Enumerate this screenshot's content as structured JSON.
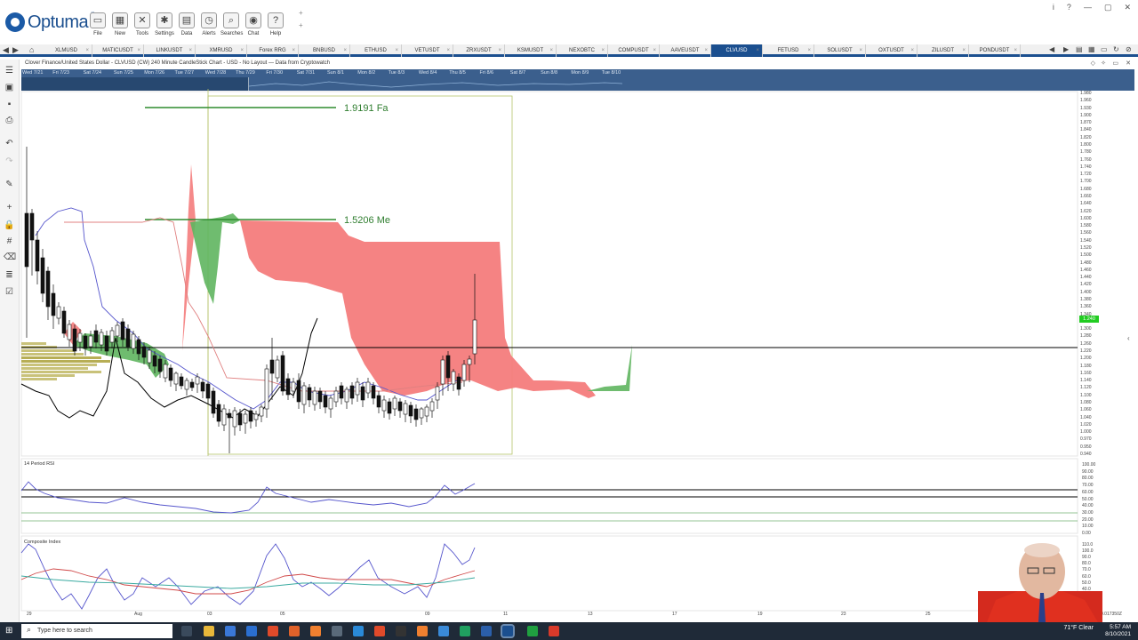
{
  "app": {
    "logo_text": "Optuma",
    "plus_mark": "+"
  },
  "ribbon": [
    {
      "label": "File",
      "icon": "folder-icon"
    },
    {
      "label": "New",
      "icon": "new-chart-icon"
    },
    {
      "label": "Tools",
      "icon": "tools-icon"
    },
    {
      "label": "Settings",
      "icon": "gear-icon"
    },
    {
      "label": "Data",
      "icon": "data-icon"
    },
    {
      "label": "Alerts",
      "icon": "alarm-clock-icon"
    },
    {
      "label": "Searches",
      "icon": "search-icon"
    },
    {
      "label": "Chat",
      "icon": "chat-icon"
    },
    {
      "label": "Help",
      "icon": "help-icon"
    }
  ],
  "window_controls": [
    "i",
    "?",
    "—",
    "▢",
    "✕"
  ],
  "tabs": [
    "XLMUSD",
    "MATICUSDT",
    "LINKUSDT",
    "XMRUSD",
    "Forex RRG",
    "BNBUSD",
    "ETHUSD",
    "VETUSDT",
    "ZRXUSDT",
    "KSMUSDT",
    "NEXOBTC",
    "COMPUSDT",
    "AAVEUSDT",
    "CLVUSD",
    "FETUSD",
    "SOLUSDT",
    "OXTUSDT",
    "ZILUSDT",
    "PONDUSDT"
  ],
  "active_tab": "CLVUSD",
  "chart_title": "Clover Finance/United States Dollar - CLVUSD (CW) 240 Minute CandleStick Chart - USD - No Layout — Data from Cryptowatch",
  "date_strip": [
    "Wed 7/21",
    "Fri 7/23",
    "Sat 7/24",
    "Sun 7/25",
    "Mon 7/26",
    "Tue 7/27",
    "Wed 7/28",
    "Thu 7/29",
    "Fri 7/30",
    "Sat 7/31",
    "Sun 8/1",
    "Mon 8/2",
    "Tue 8/3",
    "Wed 8/4",
    "Thu 8/5",
    "Fri 8/6",
    "Sat 8/7",
    "Sun 8/8",
    "Mon 8/9",
    "Tue 8/10"
  ],
  "annotations": {
    "fib_high": "1.9191  Fa",
    "fib_mid": "1.5206  Me"
  },
  "price_axis": [
    "1.980",
    "1.960",
    "1.930",
    "1.900",
    "1.870",
    "1.840",
    "1.820",
    "1.800",
    "1.780",
    "1.760",
    "1.740",
    "1.720",
    "1.700",
    "1.680",
    "1.660",
    "1.640",
    "1.620",
    "1.600",
    "1.580",
    "1.560",
    "1.540",
    "1.520",
    "1.500",
    "1.480",
    "1.460",
    "1.440",
    "1.420",
    "1.400",
    "1.380",
    "1.360",
    "1.340",
    "1.320",
    "1.300",
    "1.280",
    "1.260",
    "1.220",
    "1.200",
    "1.180",
    "1.160",
    "1.140",
    "1.120",
    "1.100",
    "1.080",
    "1.060",
    "1.040",
    "1.020",
    "1.000",
    "0.970",
    "0.950",
    "0.940"
  ],
  "last_price": "1.240",
  "rsi_panel": {
    "title": "14 Period RSI",
    "axis": [
      "100.00",
      "90.00",
      "80.00",
      "70.00",
      "60.00",
      "50.00",
      "40.00",
      "30.00",
      "20.00",
      "10.00",
      "0.00"
    ]
  },
  "composite_panel": {
    "title": "Composite Index",
    "axis": [
      "110.0",
      "100.0",
      "90.0",
      "80.0",
      "70.0",
      "60.0",
      "50.0",
      "40.0",
      "30.0",
      "20.0",
      "10.0"
    ]
  },
  "x_axis": [
    "29",
    "Aug",
    "03",
    "05",
    "09",
    "11",
    "13",
    "17",
    "19",
    "23",
    "25"
  ],
  "bottom_right": "0.017350Z",
  "taskbar": {
    "search_placeholder": "Type here to search",
    "weather": "71°F  Clear",
    "time": "5:57 AM",
    "date": "8/10/2021"
  },
  "colors": {
    "accent": "#1b4f8f",
    "cloud_red": "#f47c7c",
    "cloud_green": "#5fb55f",
    "fib_line": "#2e8b2e",
    "last_price_bg": "#22cc22"
  }
}
